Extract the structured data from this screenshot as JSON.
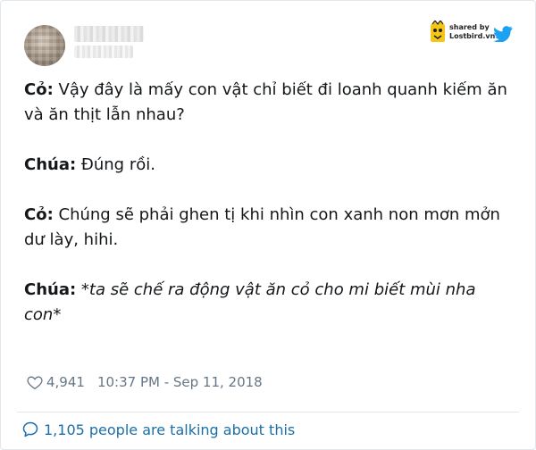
{
  "tweet": {
    "lines": [
      {
        "speaker": "Cỏ:",
        "text": " Vậy đây là mấy con vật chỉ biết đi loanh quanh kiếm ăn và ăn thịt lẫn nhau?"
      },
      {
        "speaker": "Chúa:",
        "text": " Đúng rồi."
      },
      {
        "speaker": "Cỏ:",
        "text": " Chúng sẽ phải ghen tị khi nhìn con xanh non mơn mởn dư lày, hihi."
      },
      {
        "speaker": "Chúa:",
        "text": " *ta sẽ chế ra động vật ăn cỏ cho mi biết mùi nha con*"
      }
    ]
  },
  "meta": {
    "likes": "4,941",
    "timestamp": "10:37 PM - Sep 11, 2018"
  },
  "conversation": {
    "text": "1,105 people are talking about this"
  },
  "watermark": {
    "shared_by": "shared by",
    "brand": "Lostbird.vn"
  },
  "icons": {
    "heart": "heart-icon",
    "bubble": "chat-bubble-icon",
    "twitter": "twitter-bird-icon",
    "brand_logo": "lostbird-logo-icon"
  },
  "colors": {
    "twitter_blue": "#1da1f2",
    "link_blue": "#1b6fa8",
    "muted": "#657786",
    "text": "#14171a",
    "border": "#e1e8ed"
  }
}
